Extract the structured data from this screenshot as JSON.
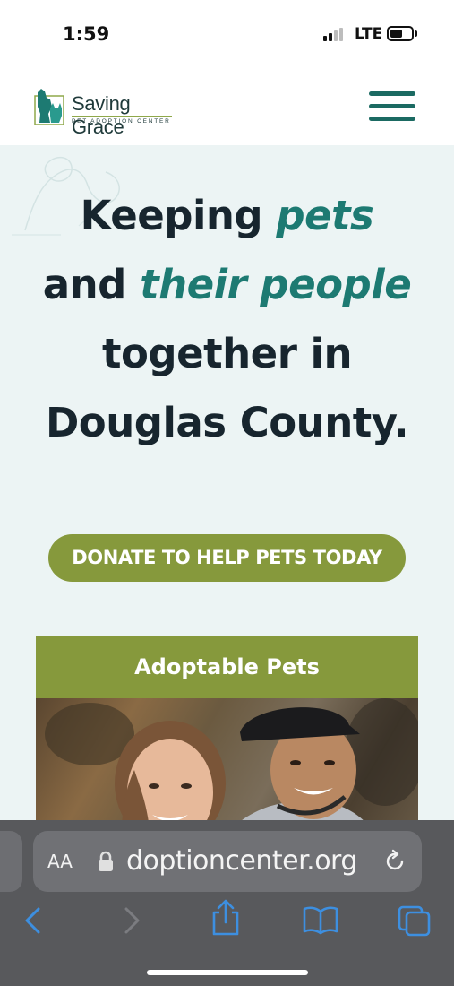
{
  "status_bar": {
    "time": "1:59",
    "network": "LTE",
    "signal_bars_filled": 2,
    "signal_bars_total": 4,
    "battery_level": 0.45
  },
  "header": {
    "logo_name": "Saving Grace",
    "logo_subtitle": "PET ADOPTION CENTER",
    "menu_icon": "hamburger-menu-icon"
  },
  "hero": {
    "headline_parts": [
      "Keeping ",
      "pets",
      "and ",
      "their people",
      "together in",
      "Douglas County."
    ],
    "donate_label": "DONATE TO HELP PETS TODAY",
    "adoptable_title": "Adoptable Pets"
  },
  "browser": {
    "text_size_label": "AA",
    "url": "doptioncenter.org",
    "icons": [
      "lock-icon",
      "reload-icon",
      "back-icon",
      "forward-icon",
      "share-icon",
      "bookmarks-icon",
      "tabs-icon"
    ]
  },
  "colors": {
    "brand_teal": "#1d7a72",
    "brand_green": "#86993c",
    "hero_background": "#ecf4f4",
    "headline_dark": "#17252e",
    "toolbar_blue": "#3d8fe0"
  }
}
